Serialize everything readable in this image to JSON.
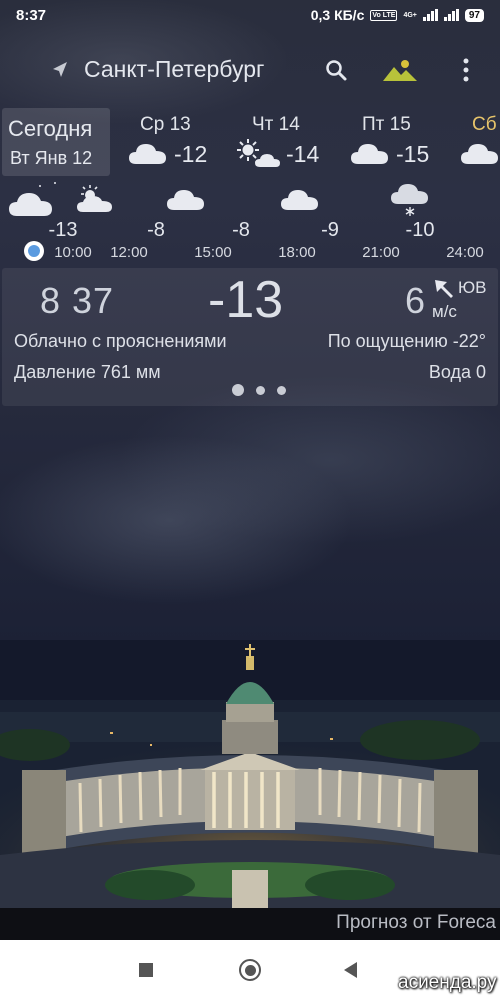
{
  "status": {
    "time": "8:37",
    "net_speed": "0,3 КБ/с",
    "volte": "Vo LTE",
    "net_type": "4G+",
    "battery": "97"
  },
  "header": {
    "city": "Санкт-Петербург",
    "icons": [
      "location-arrow-icon",
      "search-icon",
      "mountain-landscape-icon",
      "more-vert-icon"
    ]
  },
  "days": {
    "today_label": "Сегодня",
    "today_date": "Вт Янв 12",
    "items": [
      {
        "name": "Ср 13",
        "temp": "-12",
        "icon": "cloud-icon"
      },
      {
        "name": "Чт 14",
        "temp": "-14",
        "icon": "partly-sunny-icon"
      },
      {
        "name": "Пт 15",
        "temp": "-15",
        "icon": "cloud-icon"
      },
      {
        "name": "Сб",
        "temp": "",
        "icon": "cloud-icon",
        "accent": "#e6c36a"
      }
    ]
  },
  "hourly": [
    {
      "time": "10:00",
      "temp": "-13",
      "icon": "cloud-moon-icon"
    },
    {
      "time": "12:00",
      "temp": "-8",
      "icon": "cloud-sun-icon"
    },
    {
      "time": "15:00",
      "temp": "-8",
      "icon": "cloud-icon"
    },
    {
      "time": "18:00",
      "temp": "-9",
      "icon": "cloud-icon"
    },
    {
      "time": "21:00",
      "temp": "-10",
      "icon": "snow-cloud-icon"
    },
    {
      "time": "24:00",
      "temp": "",
      "icon": ""
    }
  ],
  "current": {
    "time": "8 37",
    "temp": "-13",
    "wind_speed": "6",
    "wind_dir": "ЮВ",
    "wind_unit": "м/с",
    "description": "Облачно с прояснениями",
    "feels_like": "По ощущению -22°",
    "pressure": "Давление 761 мм",
    "water": "Вода 0",
    "page_index": 1,
    "page_count": 3
  },
  "footer": {
    "credit": "Прогноз от Foreca",
    "watermark": "асиенда.ру"
  },
  "colors": {
    "accent_day": "#e6c36a",
    "mountain_icon": "#b8c23a",
    "now_dot": "#5b9be0"
  }
}
